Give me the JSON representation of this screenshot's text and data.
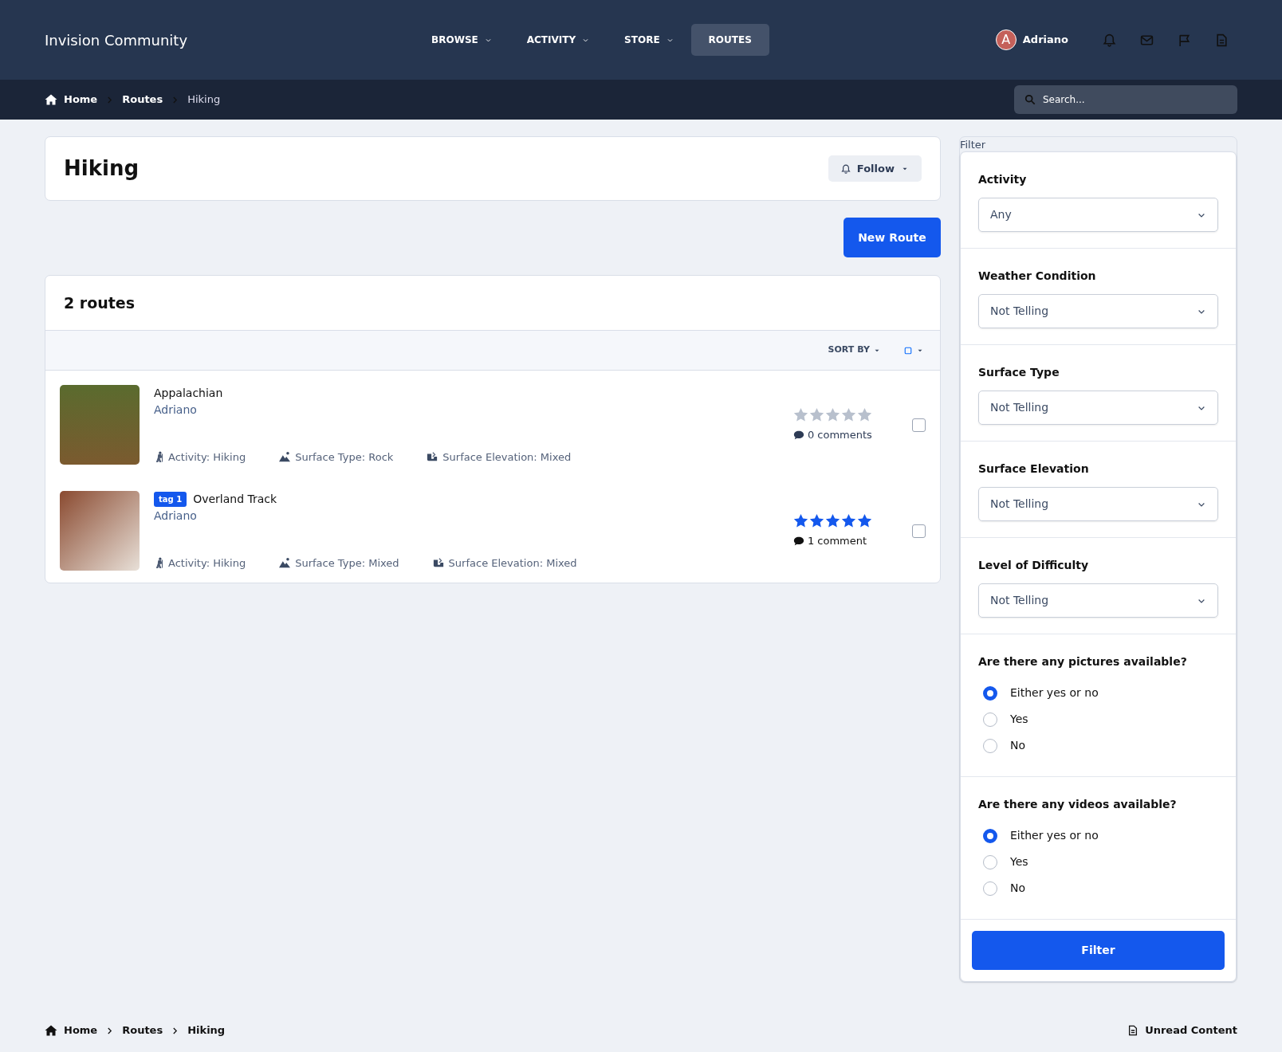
{
  "header": {
    "logo": "Invision Community",
    "nav": [
      {
        "label": "BROWSE",
        "has_menu": true,
        "selected": false
      },
      {
        "label": "ACTIVITY",
        "has_menu": true,
        "selected": false
      },
      {
        "label": "STORE",
        "has_menu": true,
        "selected": false
      },
      {
        "label": "ROUTES",
        "has_menu": false,
        "selected": true
      }
    ],
    "user": {
      "initial": "A",
      "name": "Adriano"
    }
  },
  "breadcrumb": [
    "Home",
    "Routes",
    "Hiking"
  ],
  "search": {
    "placeholder": "Search..."
  },
  "page": {
    "title": "Hiking",
    "follow": "Follow",
    "new_button": "New Route"
  },
  "list": {
    "count": "2 routes",
    "sort": "SORT BY",
    "routes": [
      {
        "title": "Appalachian",
        "author": "Adriano",
        "stars": 0,
        "comments": "0 comments",
        "checked": false,
        "meta": [
          {
            "kind": "activity",
            "text": "Activity: Hiking"
          },
          {
            "kind": "surface",
            "text": "Surface Type: Rock"
          },
          {
            "kind": "elevation",
            "text": "Surface Elevation: Mixed"
          }
        ]
      },
      {
        "tag": "tag 1",
        "title": "Overland Track",
        "author": "Adriano",
        "stars": 5,
        "comments": "1 comment",
        "checked": false,
        "meta": [
          {
            "kind": "activity",
            "text": "Activity: Hiking"
          },
          {
            "kind": "surface",
            "text": "Surface Type: Mixed"
          },
          {
            "kind": "elevation",
            "text": "Surface Elevation: Mixed"
          }
        ]
      }
    ]
  },
  "filter": {
    "legend": "Filter",
    "fields": [
      {
        "kind": "select",
        "label": "Activity",
        "value": "Any"
      },
      {
        "kind": "select",
        "label": "Weather Condition",
        "value": "Not Telling"
      },
      {
        "kind": "select",
        "label": "Surface Type",
        "value": "Not Telling"
      },
      {
        "kind": "select",
        "label": "Surface Elevation",
        "value": "Not Telling"
      },
      {
        "kind": "select",
        "label": "Level of Difficulty",
        "value": "Not Telling"
      },
      {
        "kind": "radio",
        "label": "Are there any pictures available?",
        "options": [
          {
            "label": "Either yes or no",
            "selected": true
          },
          {
            "label": "Yes",
            "selected": false
          },
          {
            "label": "No",
            "selected": false
          }
        ]
      },
      {
        "kind": "radio",
        "label": "Are there any videos available?",
        "options": [
          {
            "label": "Either yes or no",
            "selected": true
          },
          {
            "label": "Yes",
            "selected": false
          },
          {
            "label": "No",
            "selected": false
          }
        ]
      }
    ],
    "submit": "Filter"
  },
  "footer": {
    "breadcrumb": [
      "Home",
      "Routes",
      "Hiking"
    ],
    "unread": "Unread Content"
  }
}
